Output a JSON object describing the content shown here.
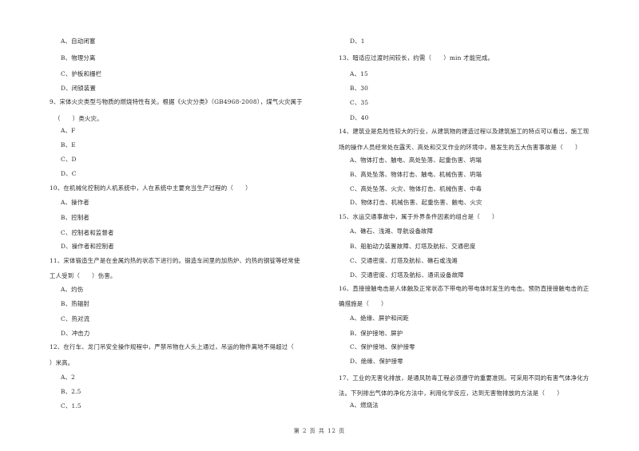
{
  "left_column": [
    {
      "type": "opt",
      "text": "A、自动闭塞"
    },
    {
      "type": "opt",
      "text": "B、物理分离"
    },
    {
      "type": "opt",
      "text": "C、护板和栅栏"
    },
    {
      "type": "opt",
      "text": "D、闭锁装置"
    },
    {
      "type": "q",
      "text": "9、宋体火灾类型与物质的燃烧特性有关。根据《火灾分类》（GB4968-2008），煤气火灾属于"
    },
    {
      "type": "q",
      "text": "（　　）类火灾。"
    },
    {
      "type": "opt",
      "text": "A、F"
    },
    {
      "type": "opt",
      "text": "B、E"
    },
    {
      "type": "opt",
      "text": "C、D"
    },
    {
      "type": "opt",
      "text": "D、C"
    },
    {
      "type": "q",
      "text": "10、在机械化控制的人机系统中，人在系统中主要充当生产过程的（　　）"
    },
    {
      "type": "opt",
      "text": "A、操作者"
    },
    {
      "type": "opt",
      "text": "B、控制者"
    },
    {
      "type": "opt",
      "text": "C、控制者和监督者"
    },
    {
      "type": "opt",
      "text": "D、操作者和控制者"
    },
    {
      "type": "q",
      "text": "11、宋体锻造生产是在金属灼热的状态下进行的。锻造车间里的加热炉、灼热的钢锭等经常使"
    },
    {
      "type": "q",
      "text": "工人受到（　　）伤害。"
    },
    {
      "type": "opt",
      "text": "A、灼伤"
    },
    {
      "type": "opt",
      "text": "B、热辐射"
    },
    {
      "type": "opt",
      "text": "C、热对流"
    },
    {
      "type": "opt",
      "text": "D、冲击力"
    },
    {
      "type": "q",
      "text": "12、在行车、龙门吊安全操作规程中，严禁吊物在人头上通过，吊运的物件离地不得超过（"
    },
    {
      "type": "q",
      "text": "）米高。"
    },
    {
      "type": "opt",
      "text": "A、2"
    },
    {
      "type": "opt",
      "text": "B、2.5"
    },
    {
      "type": "opt",
      "text": "C、1.5"
    }
  ],
  "right_column": [
    {
      "type": "opt",
      "text": "D、1"
    },
    {
      "type": "q",
      "text": "13、暗适应过渡时间较长，约需（　　）min 才能完成。"
    },
    {
      "type": "opt",
      "text": "A、15"
    },
    {
      "type": "opt",
      "text": "B、30"
    },
    {
      "type": "opt",
      "text": "C、35"
    },
    {
      "type": "opt",
      "text": "D、40"
    },
    {
      "type": "q",
      "text": "14、建筑业是危险性较大的行业，从建筑物的建造过程以及建筑施工的特点可以看出，施工现"
    },
    {
      "type": "q",
      "text": "场的操作人员经常处在露天、高处和交叉作业的环境中，易发生的五大伤害事故是（　　）"
    },
    {
      "type": "opt",
      "text": "A、物体打击、触电、高处坠落、起重伤害、坍塌"
    },
    {
      "type": "opt",
      "text": "B、高处坠落、物体打击、触电、机械伤害、坍塌"
    },
    {
      "type": "opt",
      "text": "C、高处坠落、火灾、物体打击、机械伤害、中毒"
    },
    {
      "type": "opt",
      "text": "D、物体打击、机械伤害、起重伤害、触电、火灾"
    },
    {
      "type": "q",
      "text": "15、水运交通事故中，属于外界条件因素的组合是（　　）"
    },
    {
      "type": "opt",
      "text": "A、礁石、浅滩、导航设备故障"
    },
    {
      "type": "opt",
      "text": "B、船舶动力装置故障、灯塔及航标、交通密度"
    },
    {
      "type": "opt",
      "text": "C、交通密度、灯塔及航标、礁石或浅滩"
    },
    {
      "type": "opt",
      "text": "D、交通密度、灯塔及航标、通讯设备故障"
    },
    {
      "type": "q",
      "text": "16、直接接触电击是人体触及正常状态下带电的带电体时发生的电击。预防直接接触电击的正"
    },
    {
      "type": "q",
      "text": "确措施是（　　）"
    },
    {
      "type": "opt",
      "text": "A、绝缘、屏护和间距"
    },
    {
      "type": "opt",
      "text": "B、保护接地、屏护"
    },
    {
      "type": "opt",
      "text": "C、保护接地、保护接零"
    },
    {
      "type": "opt",
      "text": "D、绝缘、保护接零"
    },
    {
      "type": "q",
      "text": "17、工业的无害化排放，是通风防毒工程必须遵守的重要准则。可采用不同的有害气体净化方"
    },
    {
      "type": "q",
      "text": "法。下列排出气体的净化方法中，利用化学反应，达到无害物排放的方法是（　　）"
    },
    {
      "type": "opt",
      "text": "A、燃烧法"
    }
  ],
  "footer": {
    "page_label": "第 2 页 共 12 页"
  }
}
